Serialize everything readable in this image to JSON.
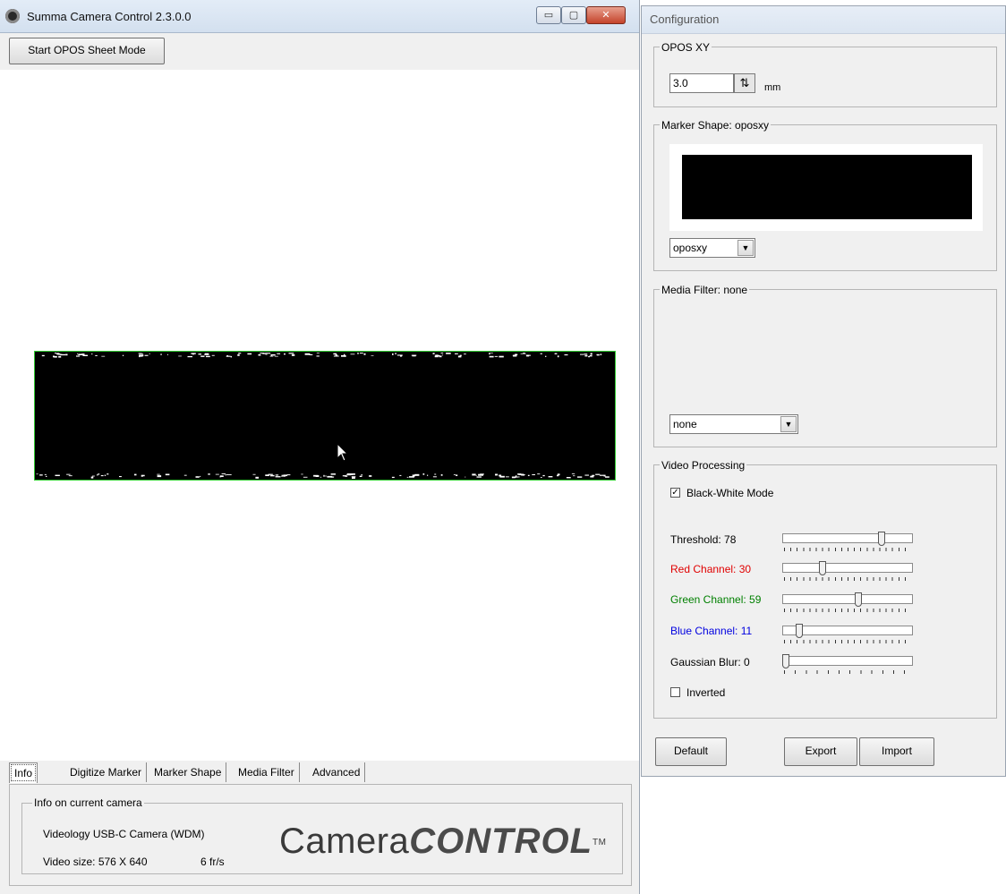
{
  "main": {
    "title": "Summa Camera Control 2.3.0.0",
    "window_buttons": {
      "minimize": "▭",
      "maximize": "▢",
      "close": "✕"
    },
    "start_button": "Start OPOS Sheet Mode",
    "tabs": [
      {
        "label": "Info",
        "active": true
      },
      {
        "label": "Digitize Marker"
      },
      {
        "label": "Marker Shape"
      },
      {
        "label": "Media Filter"
      },
      {
        "label": "Advanced"
      }
    ],
    "info": {
      "legend": "Info on current camera",
      "camera": "Videology USB-C Camera (WDM)",
      "video_size": "Video size: 576 X 640",
      "frame_rate": "6 fr/s"
    },
    "logo": {
      "light": "Camera",
      "strong": "CONTROL",
      "tm": "TM"
    }
  },
  "config": {
    "title": "Configuration",
    "opos": {
      "legend": "OPOS XY",
      "value": "3.0",
      "unit": "mm",
      "spin_glyph": "⇅"
    },
    "marker": {
      "legend": "Marker Shape: oposxy",
      "selected": "oposxy"
    },
    "media": {
      "legend": "Media Filter: none",
      "selected": "none"
    },
    "video": {
      "legend": "Video Processing",
      "bw_checked": true,
      "bw_label": "Black-White Mode",
      "check_glyph": "✓",
      "threshold": {
        "label": "Threshold: 78",
        "value": 78,
        "color": "#000000"
      },
      "red": {
        "label": "Red Channel: 30",
        "value": 30,
        "color": "#e00000"
      },
      "green": {
        "label": "Green Channel: 59",
        "value": 59,
        "color": "#008000"
      },
      "blue": {
        "label": "Blue Channel: 11",
        "value": 11,
        "color": "#0000e0"
      },
      "blur": {
        "label": "Gaussian Blur: 0",
        "value": 0,
        "color": "#000000"
      },
      "inverted_checked": false,
      "inverted_label": "Inverted"
    },
    "buttons": {
      "default": "Default",
      "export": "Export",
      "import": "Import"
    }
  },
  "colors": {
    "frame_outline": "#33cc33",
    "titlebar": "#dbe5f1"
  },
  "icons": {
    "app": "camera-app-icon",
    "cursor": "mouse-pointer-icon",
    "dropdown": "chevron-down-icon"
  }
}
